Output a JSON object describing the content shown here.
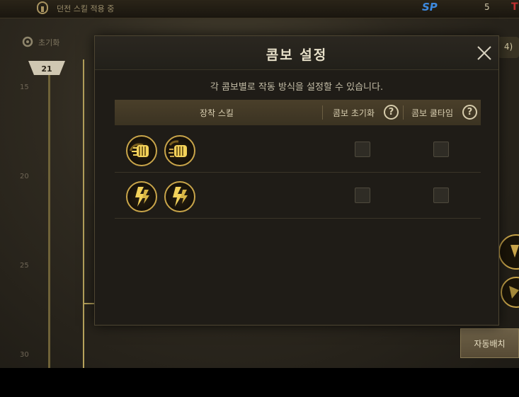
{
  "background": {
    "top_title": "던전 스킬 적용 중",
    "sp_label": "SP",
    "sp_value": "5",
    "red_mark": "T",
    "reset_label": "초기화",
    "level_marker": "21",
    "level_numbers": [
      "15",
      "20",
      "25",
      "30"
    ],
    "right_badge": "4)",
    "auto_button": "자동배치"
  },
  "dialog": {
    "title": "콤보 설정",
    "description": "각 콤보별로 작동 방식을 설정할 수 있습니다.",
    "columns": {
      "skills": "장착 스킬",
      "reset": "콤보 초기화",
      "cooldown": "콤보 쿨타임",
      "help_glyph": "?"
    },
    "rows": [
      {
        "skill_icons": [
          "fist-skill-icon",
          "fist-skill-icon"
        ],
        "combo_reset": false,
        "combo_cooldown": false
      },
      {
        "skill_icons": [
          "lightning-skill-icon",
          "lightning-skill-icon"
        ],
        "combo_reset": false,
        "combo_cooldown": false
      }
    ]
  },
  "colors": {
    "gold": "#c9a54a",
    "header_bg": "#3b3322",
    "panel_bg": "#1f1c17"
  }
}
